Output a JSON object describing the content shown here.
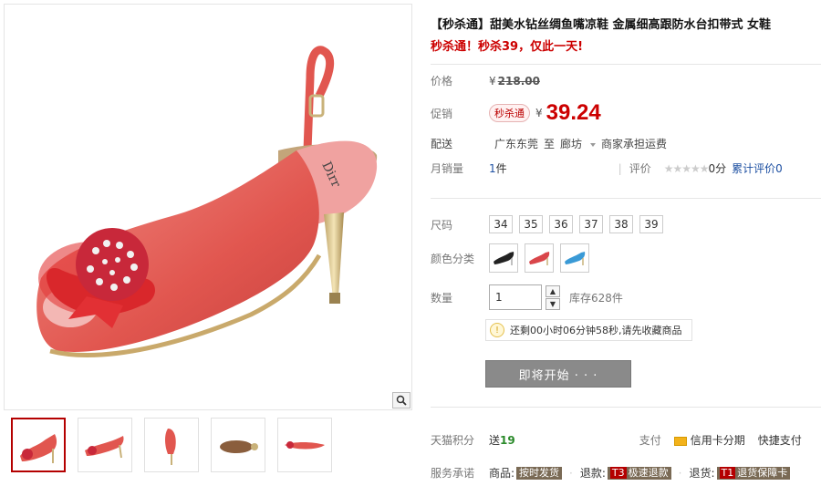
{
  "product": {
    "title": "【秒杀通】甜美水钻丝绸鱼嘴凉鞋 金属细高跟防水台扣带式 女鞋",
    "promo_line": "秒杀通！秒杀39，仅此一天!"
  },
  "price": {
    "label": "价格",
    "currency": "¥",
    "original": "218.00"
  },
  "promotion": {
    "label": "促销",
    "tag": "秒杀通",
    "currency": "¥",
    "current": "39.24"
  },
  "shipping": {
    "label": "配送",
    "from": "广东东莞",
    "to_word": "至",
    "to": "廊坊",
    "fee": "商家承担运费"
  },
  "sales": {
    "label": "月销量",
    "count": "1",
    "unit": "件",
    "rating_label": "评价",
    "stars": "★★★★★",
    "score": "0分",
    "cumulative": "累计评价0"
  },
  "sizes": {
    "label": "尺码",
    "options": [
      "34",
      "35",
      "36",
      "37",
      "38",
      "39"
    ]
  },
  "colors": {
    "label": "颜色分类",
    "swatches": [
      {
        "name": "black",
        "color": "#222222"
      },
      {
        "name": "red",
        "color": "#d9464a"
      },
      {
        "name": "blue",
        "color": "#3a9ad6"
      }
    ]
  },
  "quantity": {
    "label": "数量",
    "value": "1",
    "stock": "库存628件"
  },
  "notice": {
    "text": "还剩00小时06分钟58秒,请先收藏商品"
  },
  "buy_button": {
    "label": "即将开始 · · ·"
  },
  "points": {
    "label": "天猫积分",
    "prefix": "送",
    "value": "19",
    "pay_label": "支付",
    "credit": "信用卡分期",
    "quick_pay": "快捷支付"
  },
  "service": {
    "label": "服务承诺",
    "goods_label": "商品:",
    "goods_tag": "按时发货",
    "refund_label": "退款:",
    "refund_t": "T3",
    "refund_tag": "极速退款",
    "return_label": "退货:",
    "return_t": "T1",
    "return_tag": "退货保障卡"
  },
  "colors_theme": {
    "price_red": "#cc0000",
    "link_blue": "#1e50a2",
    "shoe_coral": "#e5645f"
  }
}
